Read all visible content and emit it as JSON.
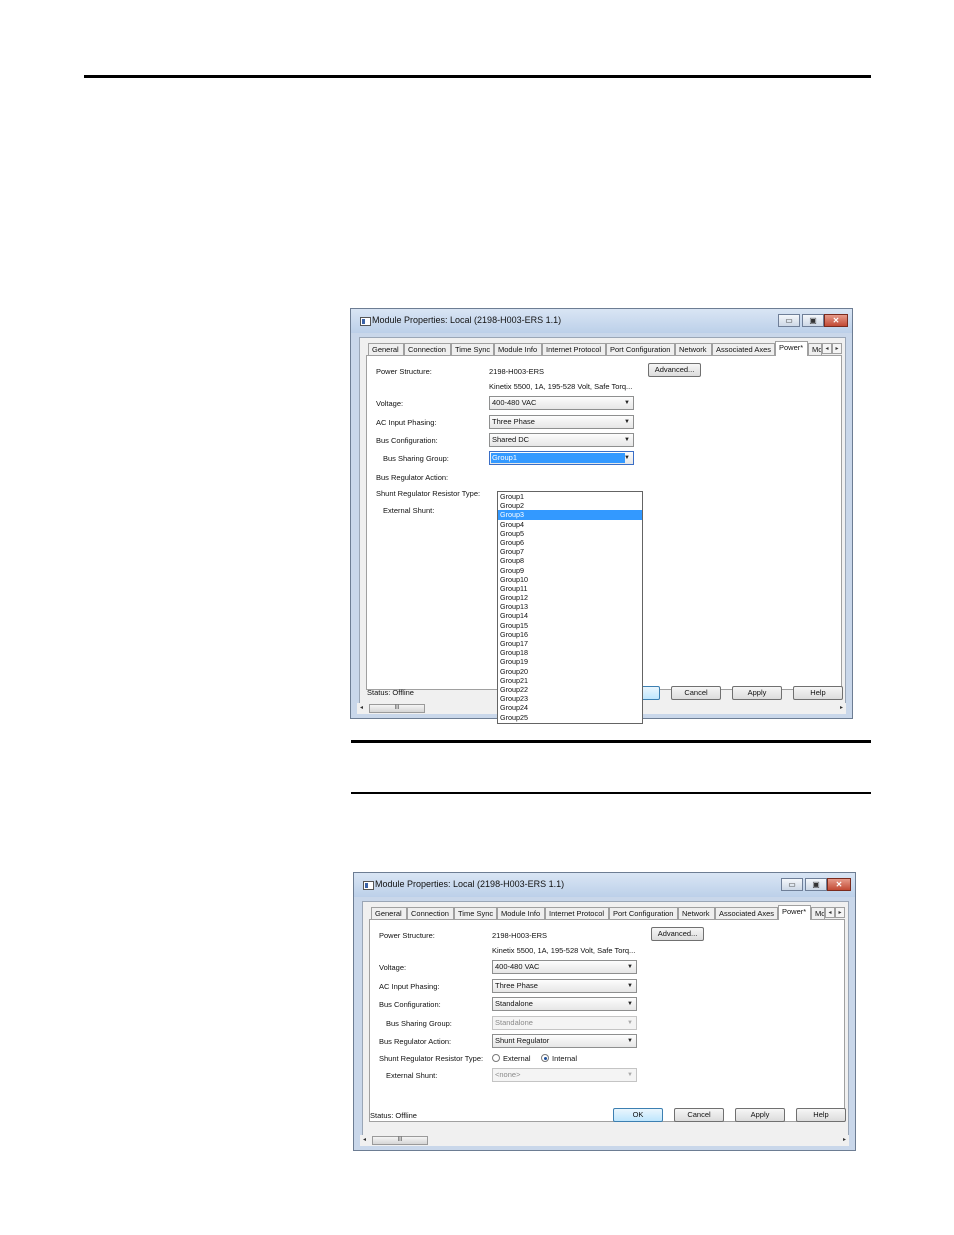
{
  "dialogs": [
    {
      "title": "Module Properties: Local (2198-H003-ERS 1.1)",
      "tabs": [
        "General",
        "Connection",
        "Time Sync",
        "Module Info",
        "Internet Protocol",
        "Port Configuration",
        "Network",
        "Associated Axes",
        "Power*",
        "Mo"
      ],
      "active_tab": "Power*",
      "power_structure_label": "Power Structure:",
      "power_structure_value": "2198-H003-ERS",
      "power_structure_desc": "Kinetix 5500, 1A, 195-528 Volt, Safe Torq...",
      "advanced_label": "Advanced...",
      "voltage_label": "Voltage:",
      "voltage_value": "400-480 VAC",
      "phasing_label": "AC Input Phasing:",
      "phasing_value": "Three Phase",
      "bus_config_label": "Bus Configuration:",
      "bus_config_value": "Shared DC",
      "bus_group_label": "Bus Sharing Group:",
      "bus_group_value": "Group1",
      "bus_reg_label": "Bus Regulator Action:",
      "shunt_type_label": "Shunt Regulator Resistor Type:",
      "ext_shunt_label": "External Shunt:",
      "status": "Status:  Offline",
      "ok_label": "OK",
      "cancel_label": "Cancel",
      "apply_label": "Apply",
      "help_label": "Help",
      "scroll_grip": "III",
      "dropdown_items": [
        "Group1",
        "Group2",
        "Group3",
        "Group4",
        "Group5",
        "Group6",
        "Group7",
        "Group8",
        "Group9",
        "Group10",
        "Group11",
        "Group12",
        "Group13",
        "Group14",
        "Group15",
        "Group16",
        "Group17",
        "Group18",
        "Group19",
        "Group20",
        "Group21",
        "Group22",
        "Group23",
        "Group24",
        "Group25"
      ],
      "dropdown_highlighted": "Group3"
    },
    {
      "title": "Module Properties: Local (2198-H003-ERS 1.1)",
      "tabs": [
        "General",
        "Connection",
        "Time Sync",
        "Module Info",
        "Internet Protocol",
        "Port Configuration",
        "Network",
        "Associated Axes",
        "Power*",
        "Mo"
      ],
      "active_tab": "Power*",
      "power_structure_label": "Power Structure:",
      "power_structure_value": "2198-H003-ERS",
      "power_structure_desc": "Kinetix 5500, 1A, 195-528 Volt, Safe Torq...",
      "advanced_label": "Advanced...",
      "voltage_label": "Voltage:",
      "voltage_value": "400-480 VAC",
      "phasing_label": "AC Input Phasing:",
      "phasing_value": "Three Phase",
      "bus_config_label": "Bus Configuration:",
      "bus_config_value": "Standalone",
      "bus_group_label": "Bus Sharing Group:",
      "bus_group_value": "Standalone",
      "bus_reg_label": "Bus Regulator Action:",
      "bus_reg_value": "Shunt Regulator",
      "shunt_type_label": "Shunt Regulator Resistor Type:",
      "shunt_external": "External",
      "shunt_internal": "Internal",
      "shunt_selected": "Internal",
      "ext_shunt_label": "External Shunt:",
      "ext_shunt_value": "<none>",
      "status": "Status:  Offline",
      "ok_label": "OK",
      "cancel_label": "Cancel",
      "apply_label": "Apply",
      "help_label": "Help",
      "scroll_grip": "III"
    }
  ]
}
